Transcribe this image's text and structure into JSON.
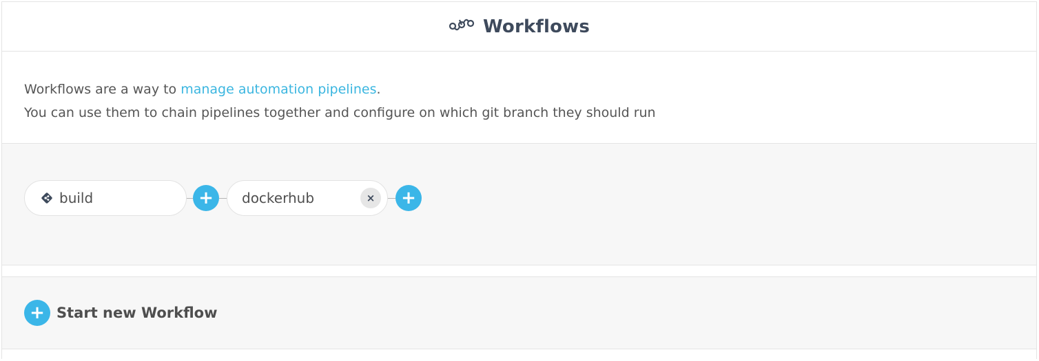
{
  "header": {
    "title": "Workflows",
    "icon": "workflow-icon"
  },
  "description": {
    "line1_prefix": "Workflows are a way to ",
    "line1_link": "manage automation pipelines",
    "line1_suffix": ".",
    "line2": "You can use them to chain pipelines together and configure on which git branch they should run"
  },
  "workflow": {
    "steps": [
      {
        "label": "build",
        "icon": "git-icon",
        "removable": false
      },
      {
        "label": "dockerhub",
        "icon": "",
        "removable": true
      }
    ],
    "add_symbol": "+",
    "remove_symbol": "×"
  },
  "start": {
    "label": "Start new Workflow",
    "add_symbol": "+"
  },
  "colors": {
    "accent": "#3bb6e8",
    "link": "#3bb6e0",
    "title": "#3e4a5c",
    "panel_bg": "#f7f7f7"
  }
}
